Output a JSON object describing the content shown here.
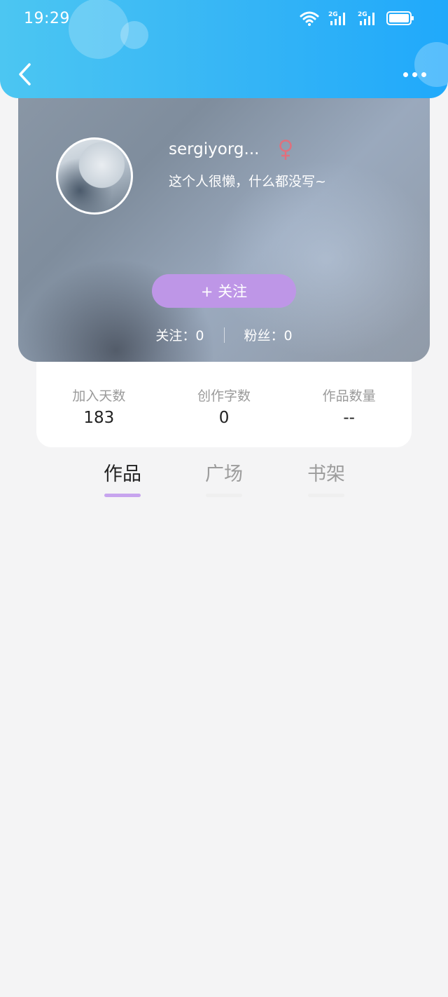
{
  "status_bar": {
    "time": "19:29",
    "icons": [
      "wifi-icon",
      "signal-2g-icon",
      "signal-2g-icon",
      "battery-icon"
    ]
  },
  "nav": {
    "back_icon": "chevron-left-icon",
    "more_icon": "more-dots-icon"
  },
  "profile": {
    "username": "sergiyorg...",
    "gender_icon": "female-icon",
    "gender_color": "#e0707d",
    "bio": "这个人很懒，什么都没写~",
    "follow_button_label": "+  关注",
    "following_label": "关注：",
    "following_count": "0",
    "followers_label": "粉丝：",
    "followers_count": "0"
  },
  "stats": [
    {
      "label": "加入天数",
      "value": "183"
    },
    {
      "label": "创作字数",
      "value": "0"
    },
    {
      "label": "作品数量",
      "value": "--"
    }
  ],
  "tabs": [
    {
      "label": "作品",
      "active": true
    },
    {
      "label": "广场",
      "active": false
    },
    {
      "label": "书架",
      "active": false
    }
  ],
  "colors": {
    "header_start": "#4cc6f2",
    "header_end": "#20a9fb",
    "accent": "#be96e7",
    "tab_indicator": "#c7a4ee",
    "background": "#f4f4f5"
  }
}
